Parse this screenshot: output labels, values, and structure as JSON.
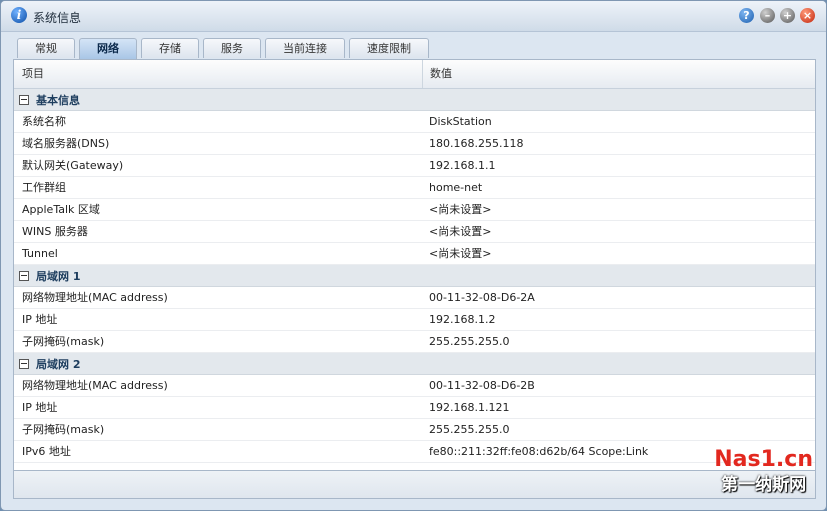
{
  "window": {
    "title": "系统信息"
  },
  "tabs": [
    {
      "label": "常规"
    },
    {
      "label": "网络"
    },
    {
      "label": "存储"
    },
    {
      "label": "服务"
    },
    {
      "label": "当前连接"
    },
    {
      "label": "速度限制"
    }
  ],
  "active_tab": "网络",
  "grid": {
    "col_item": "项目",
    "col_value": "数值"
  },
  "groups": [
    {
      "title": "基本信息",
      "rows": [
        {
          "item": "系统名称",
          "value": "DiskStation"
        },
        {
          "item": "域名服务器(DNS)",
          "value": "180.168.255.118"
        },
        {
          "item": "默认网关(Gateway)",
          "value": "192.168.1.1"
        },
        {
          "item": "工作群组",
          "value": "home-net"
        },
        {
          "item": "AppleTalk 区域",
          "value": "<尚未设置>"
        },
        {
          "item": "WINS 服务器",
          "value": "<尚未设置>"
        },
        {
          "item": "Tunnel",
          "value": "<尚未设置>"
        }
      ]
    },
    {
      "title": "局域网 1",
      "rows": [
        {
          "item": "网络物理地址(MAC address)",
          "value": "00-11-32-08-D6-2A"
        },
        {
          "item": "IP 地址",
          "value": "192.168.1.2"
        },
        {
          "item": "子网掩码(mask)",
          "value": "255.255.255.0"
        }
      ]
    },
    {
      "title": "局域网 2",
      "rows": [
        {
          "item": "网络物理地址(MAC address)",
          "value": "00-11-32-08-D6-2B"
        },
        {
          "item": "IP 地址",
          "value": "192.168.1.121"
        },
        {
          "item": "子网掩码(mask)",
          "value": "255.255.255.0"
        },
        {
          "item": "IPv6 地址",
          "value": "fe80::211:32ff:fe08:d62b/64 Scope:Link"
        }
      ]
    }
  ],
  "watermark": {
    "line1": "Nas1.cn",
    "line2": "第一纳斯网"
  }
}
